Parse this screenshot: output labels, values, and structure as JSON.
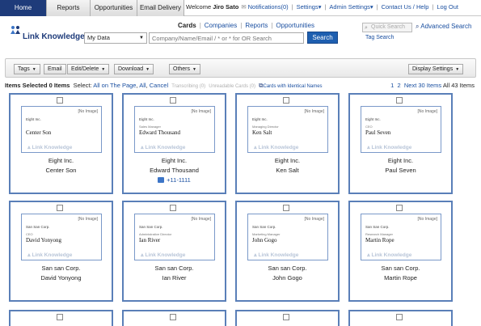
{
  "topnav": {
    "tabs": [
      "Home",
      "Reports",
      "Opportunities",
      "Email Delivery"
    ],
    "welcome_prefix": "Welcome",
    "user_name": "Jiro Sato",
    "notifications": "Notifications(0)",
    "settings": "Settings▾",
    "admin_settings": "Admin Settings▾",
    "contact_help": "Contact Us / Help",
    "logout": "Log Out"
  },
  "header": {
    "logo_text": "Link Knowledge",
    "db_select_value": "My Data",
    "search_placeholder": "Company/Name/Email / * or * for OR Search",
    "search_button": "Search",
    "section_tabs": [
      "Cards",
      "Companies",
      "Reports",
      "Opportunities"
    ],
    "active_section": "Cards",
    "quick_search_placeholder": "Quick Search",
    "advanced_search": "Advanced Search",
    "tag_search": "Tag Search"
  },
  "toolbar": {
    "tags": "Tags",
    "email": "Email",
    "edit_delete": "Edit/Delete",
    "download": "Download",
    "others": "Others",
    "display_settings": "Display Settings"
  },
  "selection": {
    "selected_text": "Items Selected 0 Items",
    "select_label": "Select:",
    "all_on_page": "All on The Page",
    "all": "All",
    "cancel": "Cancel",
    "transcribing": "Transcribing (0)",
    "unreadable": "Unreadable Cards (0)",
    "identical": "Cards with Identical Names",
    "pager_pages": [
      "1",
      "2"
    ],
    "next": "Next 30 Items",
    "total": "All 43 Items"
  },
  "cards": [
    {
      "thumb_company": "Eight Inc.",
      "thumb_title": "",
      "thumb_name": "Center Son",
      "company": "Eight Inc.",
      "person": "Center Son",
      "phone": ""
    },
    {
      "thumb_company": "Eight Inc.",
      "thumb_title": "Sales Manager",
      "thumb_name": "Edward Thousand",
      "company": "Eight Inc.",
      "person": "Edward Thousand",
      "phone": "+11-1111"
    },
    {
      "thumb_company": "Eight Inc.",
      "thumb_title": "Managing Director",
      "thumb_name": "Ken Salt",
      "company": "Eight Inc.",
      "person": "Ken Salt",
      "phone": ""
    },
    {
      "thumb_company": "Eight Inc.",
      "thumb_title": "CEO",
      "thumb_name": "Paul Seven",
      "company": "Eight Inc.",
      "person": "Paul Seven",
      "phone": ""
    },
    {
      "thumb_company": "San San Corp.",
      "thumb_title": "CEO",
      "thumb_name": "David Yonyong",
      "company": "San san Corp.",
      "person": "David Yonyong",
      "phone": ""
    },
    {
      "thumb_company": "San San Corp.",
      "thumb_title": "Administrative Director",
      "thumb_name": "Ian River",
      "company": "San san Corp.",
      "person": "Ian River",
      "phone": ""
    },
    {
      "thumb_company": "San San Corp.",
      "thumb_title": "Marketing Manager",
      "thumb_name": "John Gogo",
      "company": "San san Corp.",
      "person": "John Gogo",
      "phone": ""
    },
    {
      "thumb_company": "San San Corp.",
      "thumb_title": "Research Manager",
      "thumb_name": "Martin Rope",
      "company": "San san Corp.",
      "person": "Martin Rope",
      "phone": ""
    }
  ],
  "card_common": {
    "no_image": "[No Image]",
    "watermark": "Link Knowledge"
  },
  "colors": {
    "nav_active": "#1e3b7a",
    "accent": "#1e5fb0",
    "card_border": "#5a7fb8"
  }
}
